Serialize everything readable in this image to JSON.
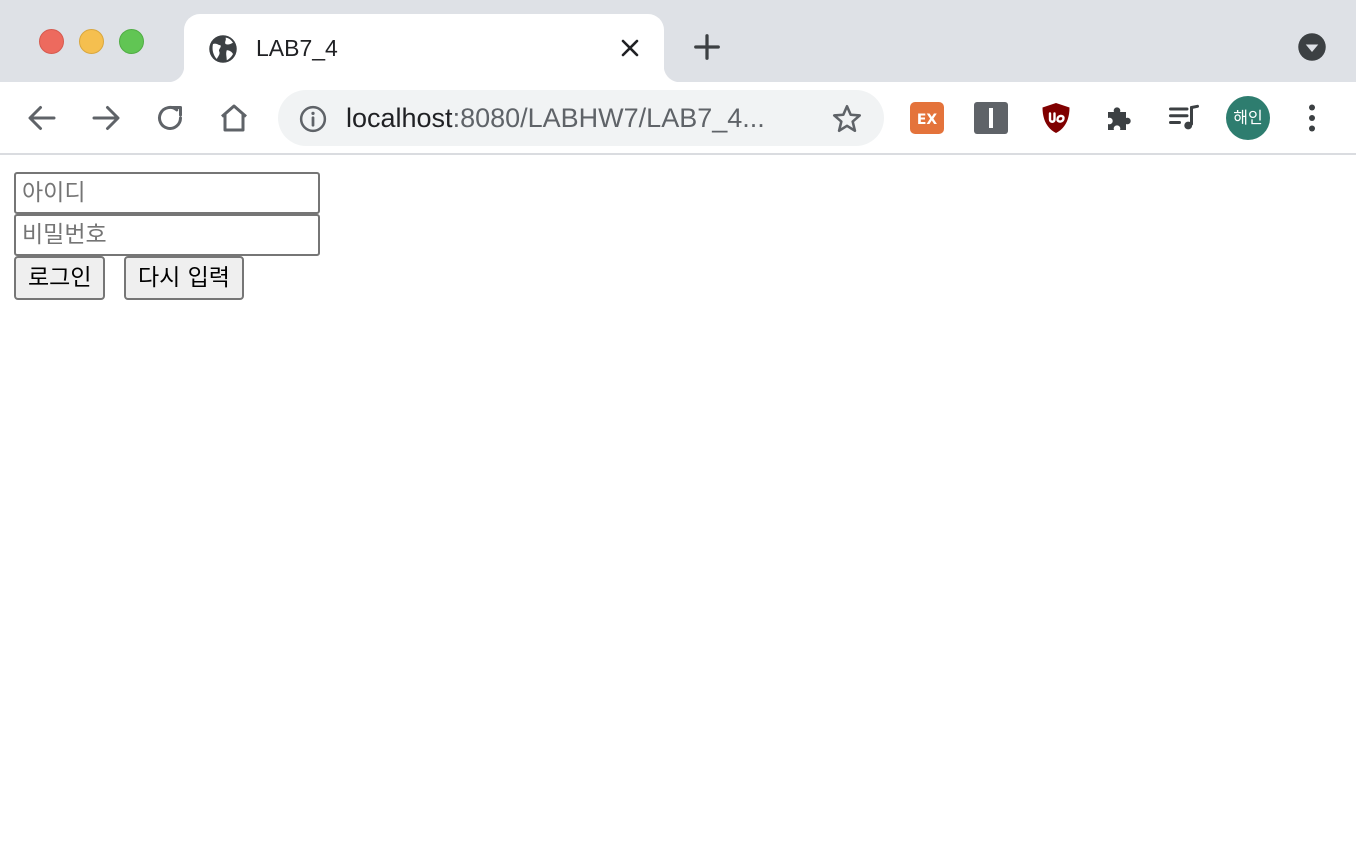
{
  "tab": {
    "title": "LAB7_4",
    "favicon": "globe-icon"
  },
  "toolbar": {
    "url_host": "localhost",
    "url_path": ":8080/LABHW7/LAB7_4...",
    "extensions": [
      {
        "name": "ex-extension",
        "label": "EX"
      },
      {
        "name": "bar-extension"
      },
      {
        "name": "ublock-extension"
      },
      {
        "name": "puzzle-extension"
      },
      {
        "name": "media-control"
      }
    ],
    "profile_label": "해인"
  },
  "form": {
    "id_placeholder": "아이디",
    "password_placeholder": "비밀번호",
    "login_label": "로그인",
    "reset_label": "다시 입력"
  },
  "colors": {
    "tabstrip": "#dee1e6",
    "ex_extension": "#e4733b",
    "ublock": "#800000",
    "profile": "#2e7d6f"
  }
}
